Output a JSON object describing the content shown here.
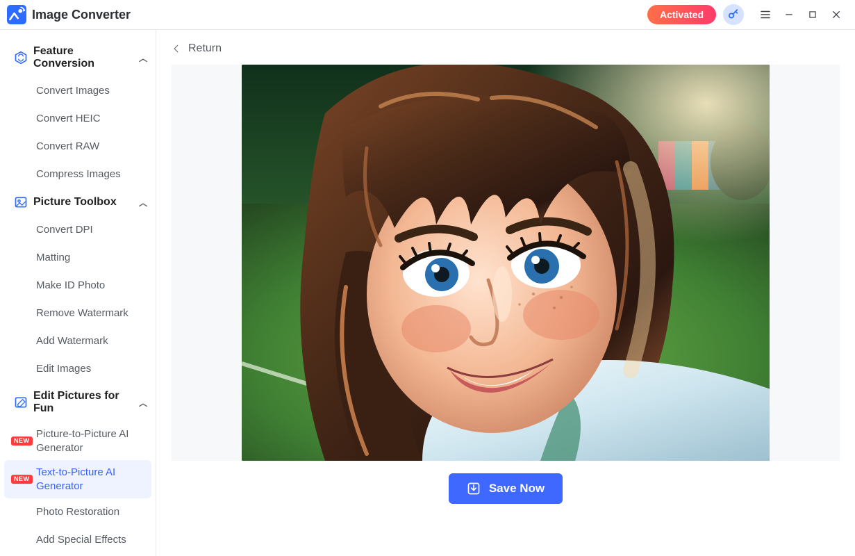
{
  "app": {
    "title": "Image Converter"
  },
  "header": {
    "activated_label": "Activated"
  },
  "sidebar": {
    "groups": [
      {
        "id": "feature",
        "label": "Feature Conversion",
        "expanded": true,
        "items": [
          {
            "label": "Convert Images"
          },
          {
            "label": "Convert HEIC"
          },
          {
            "label": "Convert RAW"
          },
          {
            "label": "Compress Images"
          }
        ]
      },
      {
        "id": "toolbox",
        "label": "Picture Toolbox",
        "expanded": true,
        "items": [
          {
            "label": "Convert DPI"
          },
          {
            "label": "Matting"
          },
          {
            "label": "Make ID Photo"
          },
          {
            "label": "Remove Watermark"
          },
          {
            "label": "Add Watermark"
          },
          {
            "label": "Edit Images"
          }
        ]
      },
      {
        "id": "fun",
        "label": "Edit Pictures for Fun",
        "expanded": true,
        "items": [
          {
            "label": "Picture-to-Picture AI Generator",
            "badge": "NEW"
          },
          {
            "label": "Text-to-Picture AI Generator",
            "badge": "NEW",
            "selected": true
          },
          {
            "label": "Photo Restoration"
          },
          {
            "label": "Add Special Effects"
          }
        ]
      }
    ]
  },
  "main": {
    "return_label": "Return",
    "save_label": "Save Now",
    "image_alt": "AI-generated portrait of a young woman with brown hair and blue eyes on a sports field"
  }
}
